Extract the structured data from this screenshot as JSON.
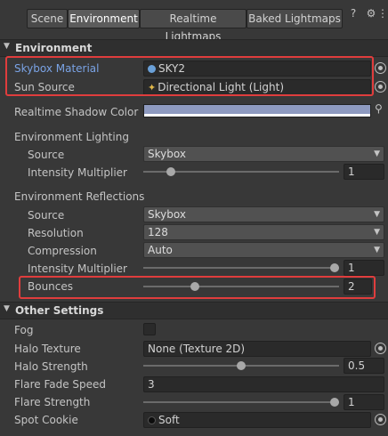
{
  "tabs": [
    {
      "label": "Scene",
      "active": false
    },
    {
      "label": "Environment",
      "active": true
    },
    {
      "label": "Realtime Lightmaps",
      "active": false
    },
    {
      "label": "Baked Lightmaps",
      "active": false
    }
  ],
  "environment": {
    "header": "Environment",
    "skybox_material_label": "Skybox Material",
    "skybox_material_value": "SKY2",
    "sun_source_label": "Sun Source",
    "sun_source_value": "Directional Light (Light)",
    "realtime_shadow_color_label": "Realtime Shadow Color",
    "realtime_shadow_color": "#8e9ac0",
    "lighting": {
      "group_label": "Environment Lighting",
      "source_label": "Source",
      "source_value": "Skybox",
      "intensity_label": "Intensity Multiplier",
      "intensity_value": "1",
      "intensity_fraction": 0.125
    },
    "reflections": {
      "group_label": "Environment Reflections",
      "source_label": "Source",
      "source_value": "Skybox",
      "resolution_label": "Resolution",
      "resolution_value": "128",
      "compression_label": "Compression",
      "compression_value": "Auto",
      "intensity_label": "Intensity Multiplier",
      "intensity_value": "1",
      "intensity_fraction": 1.0,
      "bounces_label": "Bounces",
      "bounces_value": "2",
      "bounces_fraction": 0.25
    }
  },
  "other": {
    "header": "Other Settings",
    "fog_label": "Fog",
    "fog_checked": false,
    "halo_texture_label": "Halo Texture",
    "halo_texture_value": "None (Texture 2D)",
    "halo_strength_label": "Halo Strength",
    "halo_strength_value": "0.5",
    "halo_strength_fraction": 0.5,
    "flare_fade_label": "Flare Fade Speed",
    "flare_fade_value": "3",
    "flare_strength_label": "Flare Strength",
    "flare_strength_value": "1",
    "flare_strength_fraction": 1.0,
    "spot_cookie_label": "Spot Cookie",
    "spot_cookie_value": "Soft"
  },
  "colors": {
    "highlight": "#e03d3d",
    "accent_label": "#7aa3e5"
  },
  "icons": [
    "help-icon",
    "settings-icon",
    "object-picker-icon",
    "eyedropper-icon",
    "material-icon",
    "light-icon",
    "texture-icon"
  ]
}
